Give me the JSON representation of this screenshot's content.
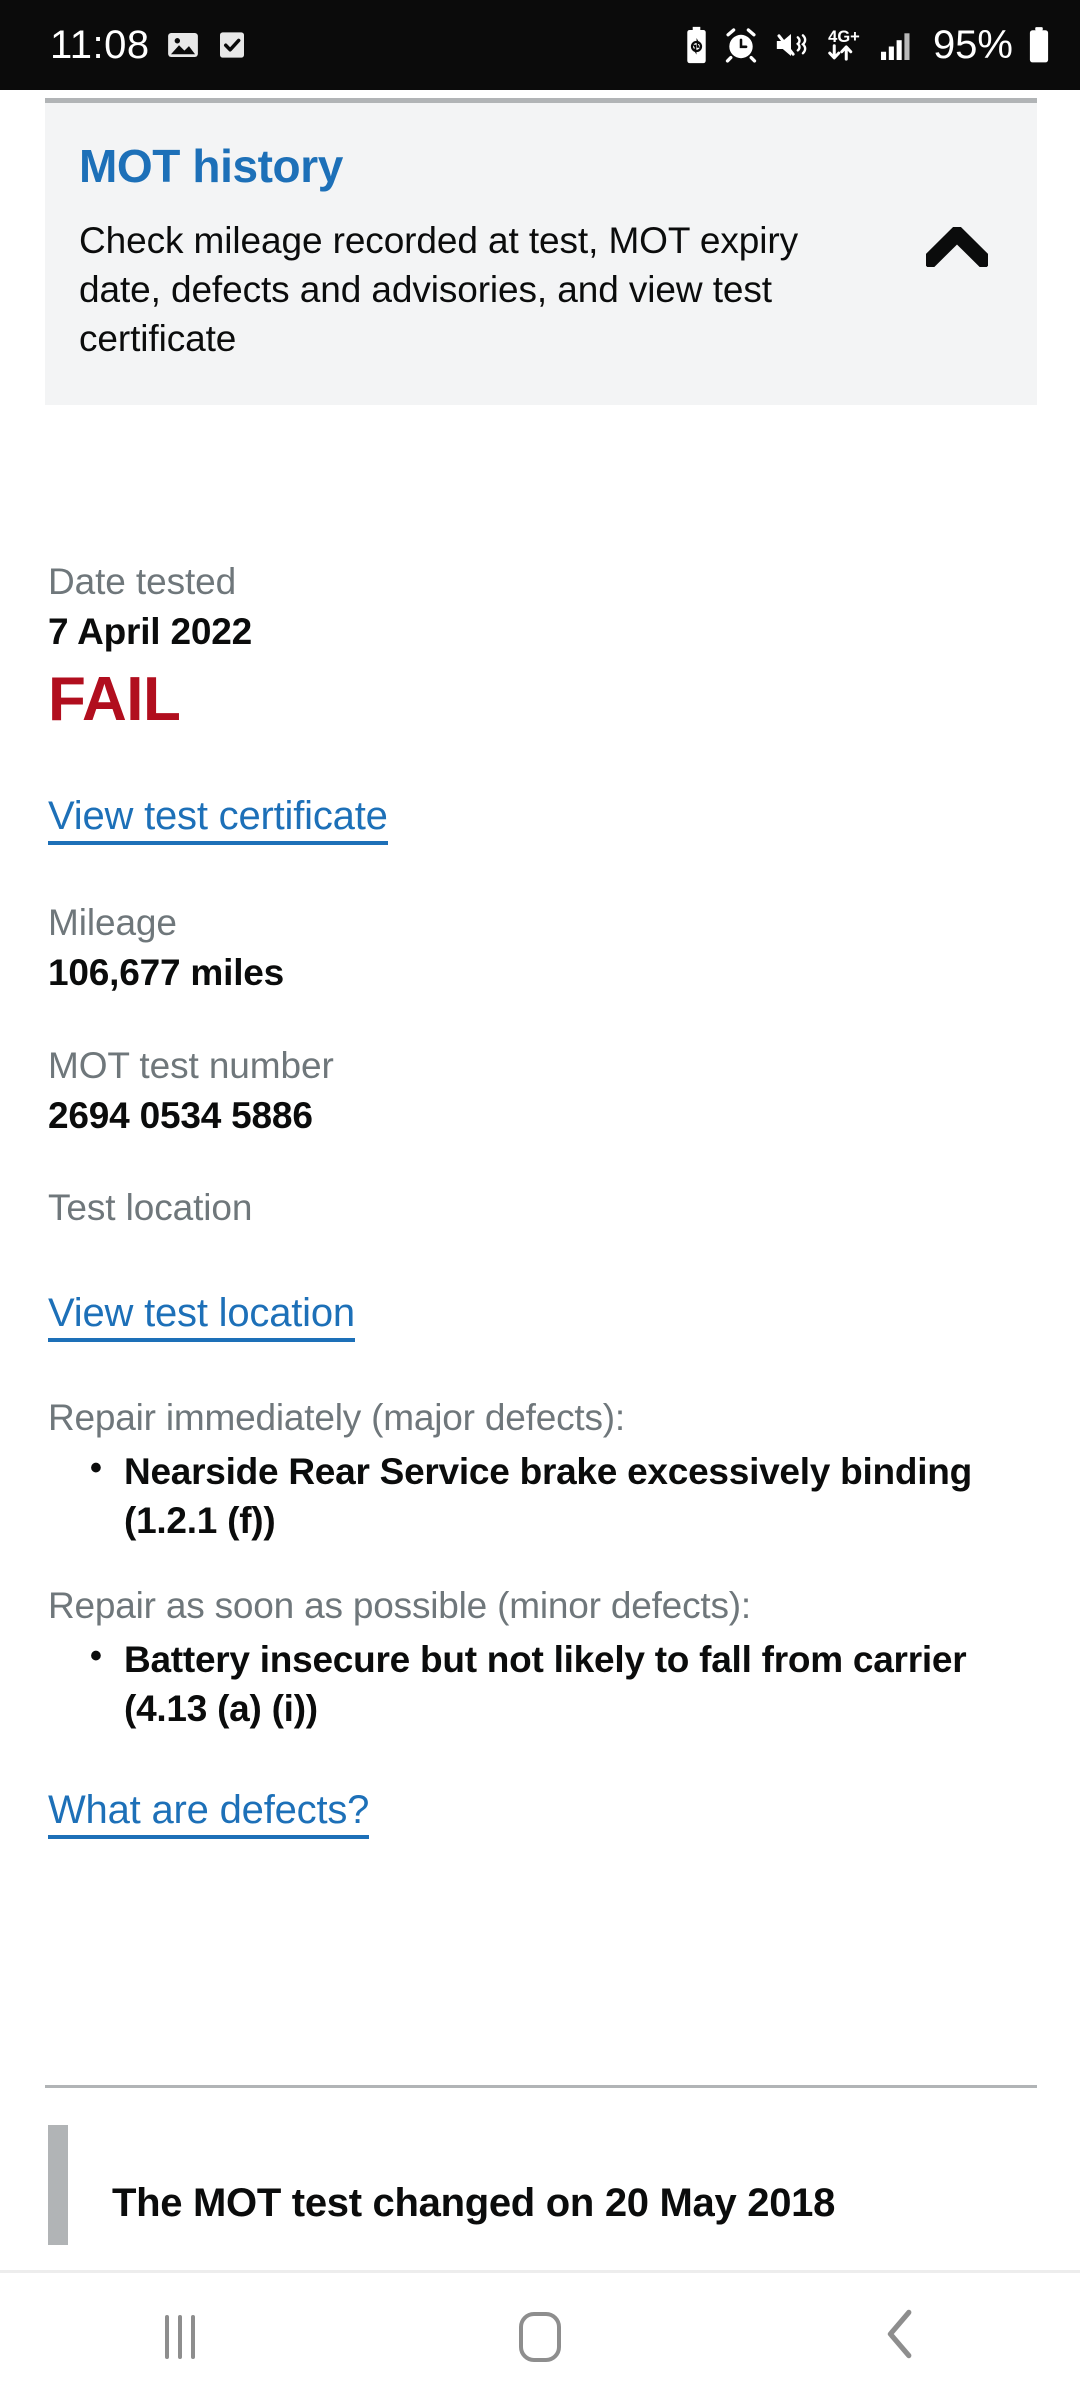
{
  "status_bar": {
    "time": "11:08",
    "battery_percent": "95%",
    "network_type": "4G+",
    "left_icons": [
      "image-icon",
      "checkbox-checked-icon"
    ],
    "right_icons": [
      "battery-saver-icon",
      "alarm-clock-icon",
      "vibrate-icon",
      "mobile-data-icon",
      "signal-bars-icon",
      "battery-icon"
    ]
  },
  "summary": {
    "title": "MOT history",
    "description": "Check mileage recorded at test, MOT expiry date, defects and advisories, and view test certificate",
    "toggle_icon": "chevron-up-icon"
  },
  "test": {
    "date_label": "Date tested",
    "date_value": "7 April 2022",
    "result": "FAIL",
    "result_color": "#b10e1e",
    "certificate_link": "View test certificate",
    "mileage_label": "Mileage",
    "mileage_value": "106,677 miles",
    "test_number_label": "MOT test number",
    "test_number_value": "2694 0534 5886",
    "location_label": "Test location",
    "location_link": "View test location"
  },
  "defects": {
    "major_heading": "Repair immediately (major defects):",
    "major_items": [
      "Nearside Rear Service brake excessively binding (1.2.1 (f))"
    ],
    "minor_heading": "Repair as soon as possible (minor defects):",
    "minor_items": [
      "Battery insecure but not likely to fall from carrier (4.13 (a) (i))"
    ],
    "help_link": "What are defects?"
  },
  "inset": {
    "text": "The MOT test changed on 20 May 2018"
  },
  "nav_bar": {
    "recents_label": "recents-button",
    "home_label": "home-button",
    "back_label": "back-button"
  },
  "colors": {
    "link_blue": "#1d70b8",
    "fail_red": "#b10e1e",
    "card_grey": "#f3f4f5",
    "label_grey": "#6f777b"
  }
}
